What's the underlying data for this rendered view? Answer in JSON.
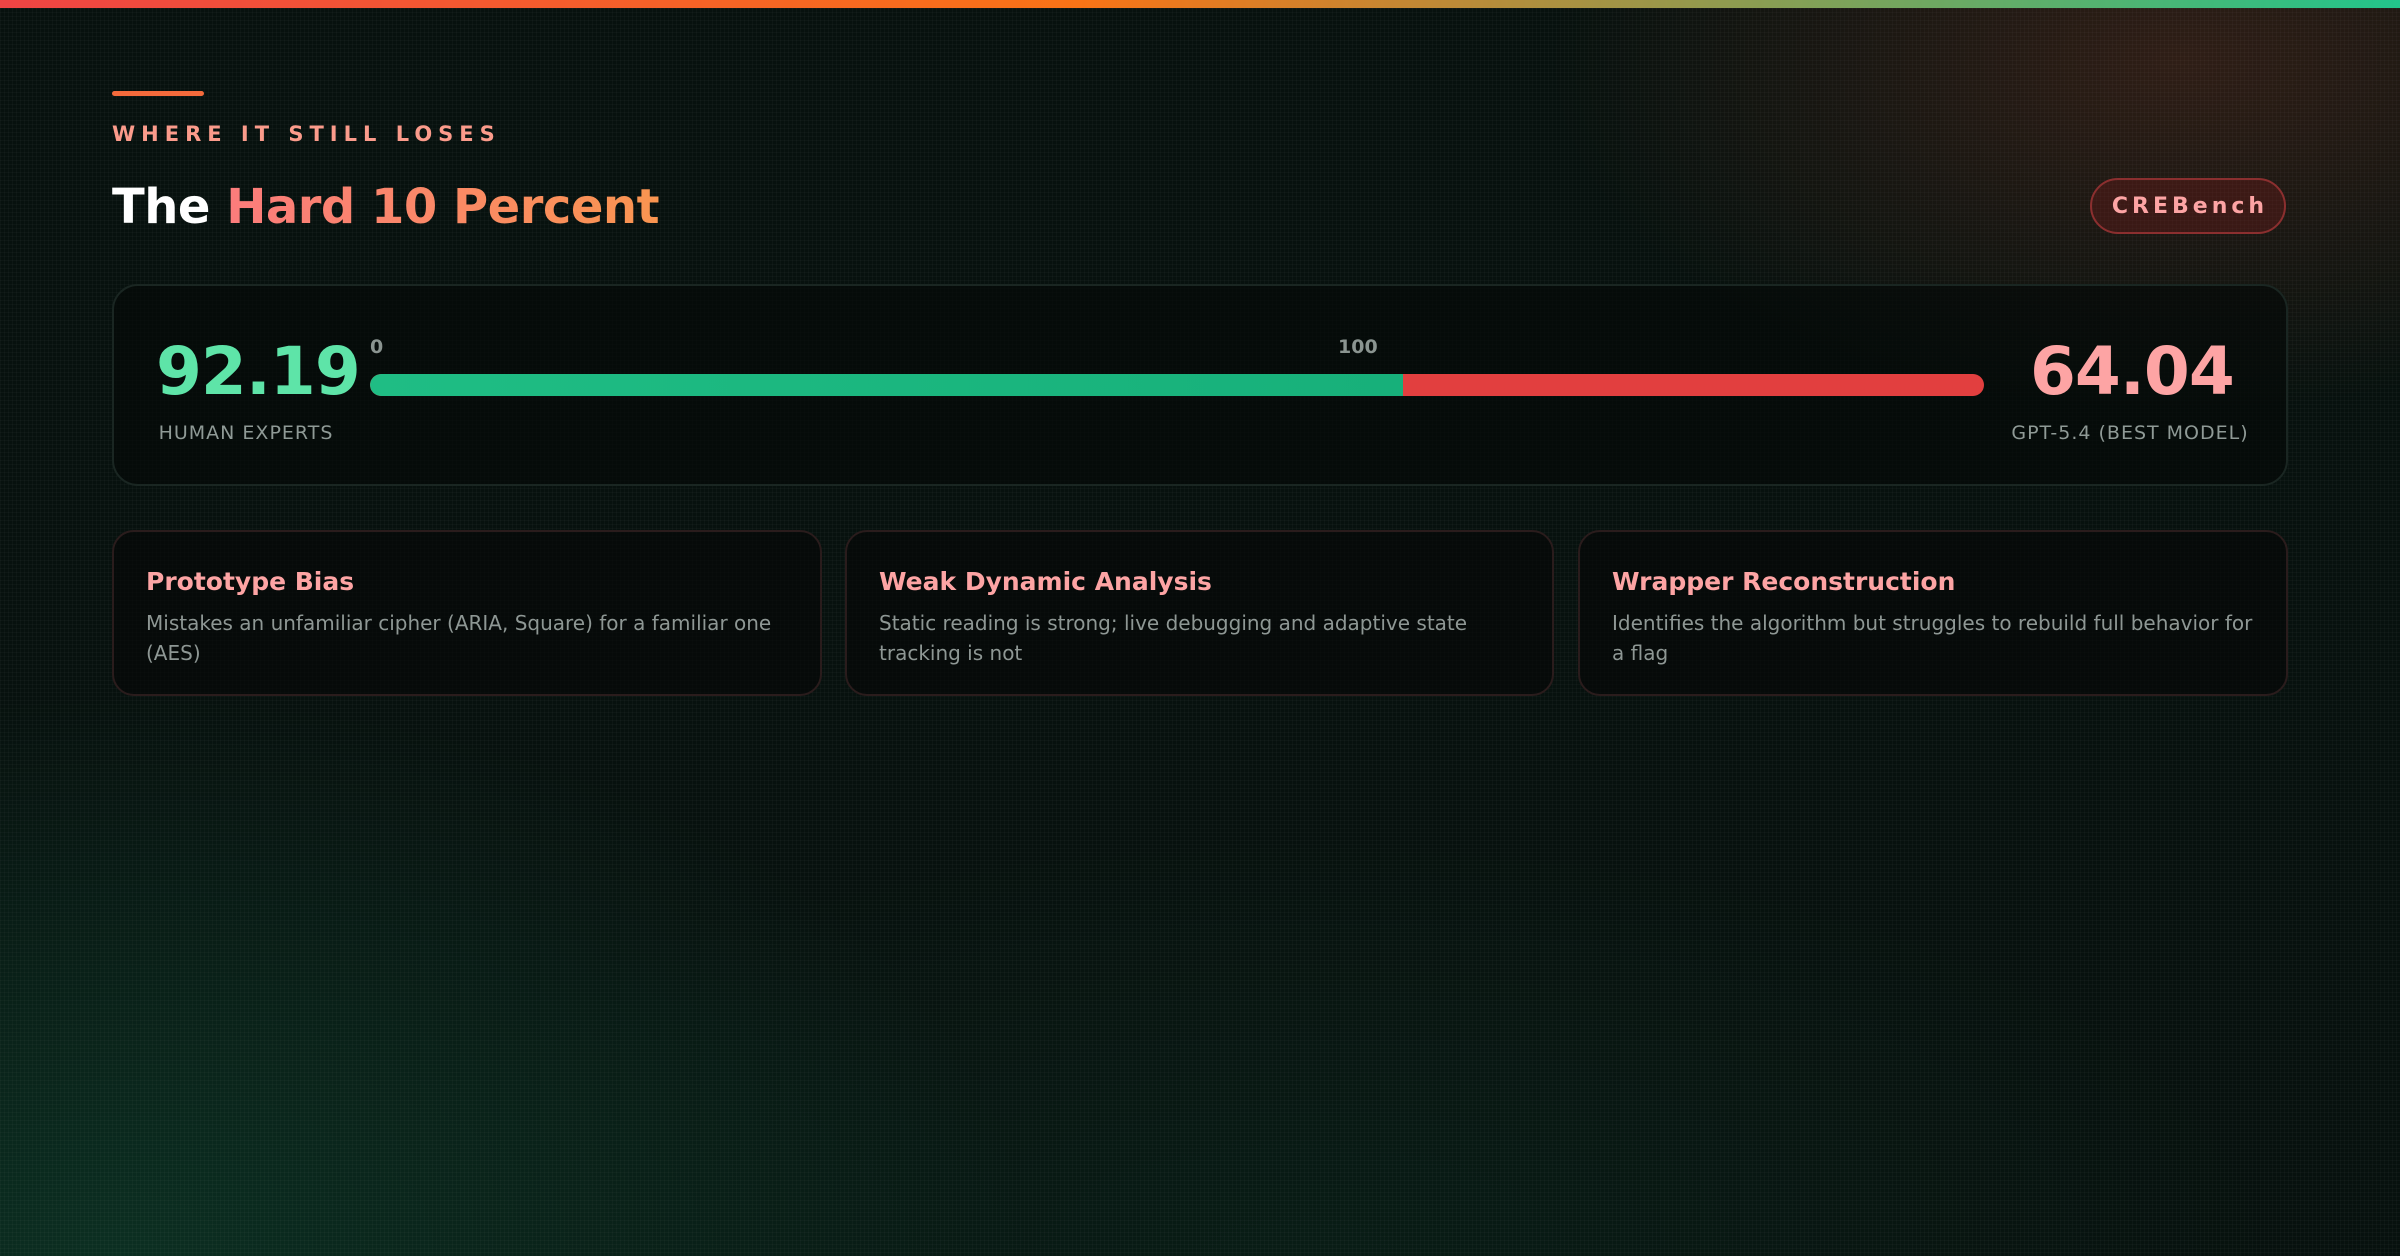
{
  "header": {
    "eyebrow": "WHERE IT STILL LOSES",
    "title_plain": "The",
    "title_accent": "Hard 10 Percent",
    "badge": "CREBench"
  },
  "scoreboard": {
    "human": {
      "value": "92.19",
      "label": "HUMAN EXPERTS"
    },
    "model": {
      "value": "64.04",
      "label": "GPT-5.4 (BEST MODEL)"
    },
    "bar": {
      "tick_start": "0",
      "tick_end": "100",
      "green_fraction": 0.64,
      "green_color": "#1fbd84",
      "red_color": "#e23f3f"
    }
  },
  "cards": [
    {
      "title": "Prototype Bias",
      "description": "Mistakes an unfamiliar cipher (ARIA, Square) for a familiar one (AES)"
    },
    {
      "title": "Weak Dynamic Analysis",
      "description": "Static reading is strong; live debugging and adaptive state tracking is not"
    },
    {
      "title": "Wrapper Reconstruction",
      "description": "Identifies the algorithm but struggles to rebuild full behavior for a flag"
    }
  ],
  "colors": {
    "accent_orange": "#f46a3b",
    "human_green": "#5ee4a8",
    "model_pink": "#fda4a4",
    "background": "#07110e"
  }
}
